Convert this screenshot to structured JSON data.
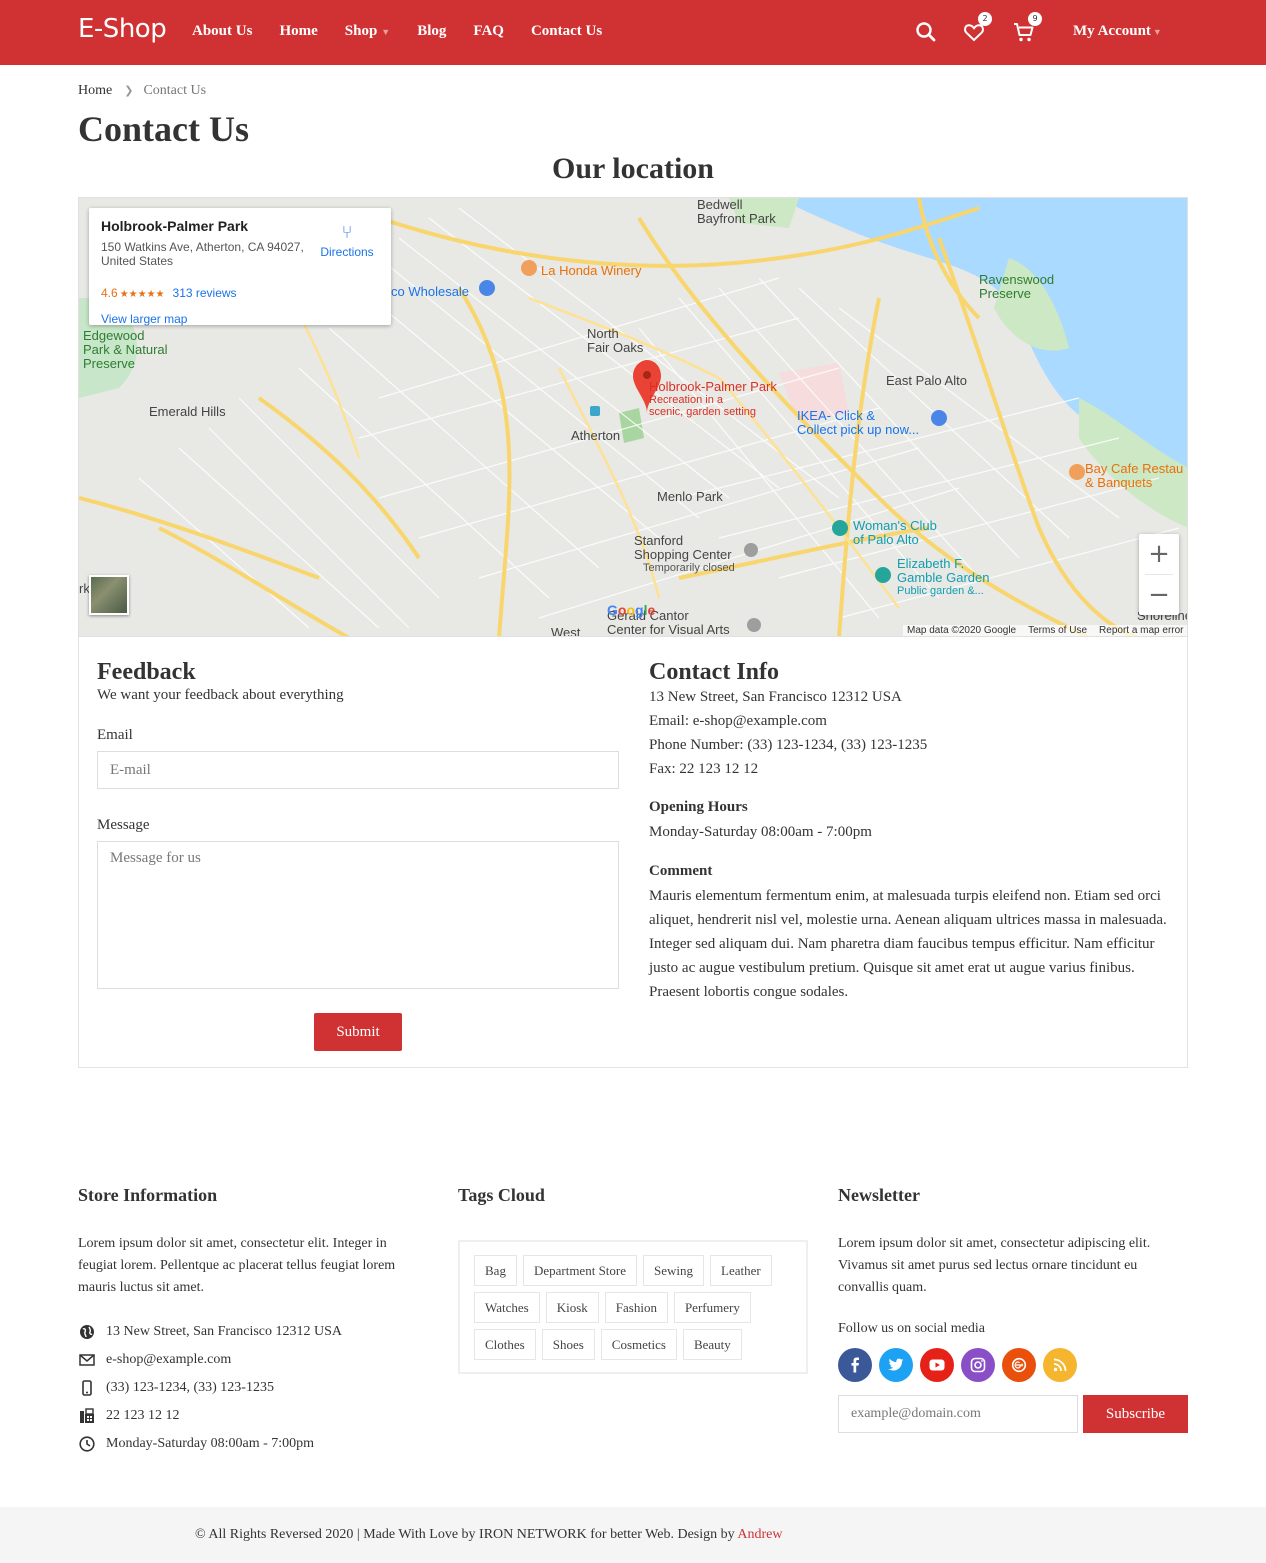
{
  "brand": {
    "logo": "E-Shop",
    "accent": "#d03233"
  },
  "nav": {
    "items": [
      "About Us",
      "Home",
      "Shop",
      "Blog",
      "FAQ",
      "Contact Us"
    ],
    "account_label": "My Account",
    "wishlist_count": "2",
    "cart_count": "9"
  },
  "breadcrumb": {
    "home": "Home",
    "current": "Contact Us"
  },
  "page": {
    "title": "Contact Us",
    "location_title": "Our location"
  },
  "map": {
    "place_name": "Holbrook-Palmer Park",
    "address": "150 Watkins Ave, Atherton, CA 94027, United States",
    "rating": "4.6",
    "stars": "★★★★★",
    "reviews": "313 reviews",
    "directions": "Directions",
    "larger_map": "View larger map",
    "labels": {
      "bedwell": "Bedwell\nBayfront Park",
      "la_honda": "La Honda Winery",
      "wholesale": "co Wholesale",
      "ravenswood": "Ravenswood\nPreserve",
      "edgewood": "Edgewood\nPark & Natural\nPreserve",
      "north_fair_oaks": "North\nFair Oaks",
      "pin_title": "Holbrook-Palmer Park",
      "pin_desc": "Recreation in a\nscenic, garden setting",
      "east_palo_alto": "East Palo Alto",
      "ikea": "IKEA- Click &\nCollect pick up now...",
      "emerald_hills": "Emerald Hills",
      "atherton": "Atherton",
      "bay_cafe": "Bay Cafe Restau\n& Banquets",
      "menlo_park": "Menlo Park",
      "womans_club": "Woman's Club\nof Palo Alto",
      "stanford": "Stanford\nShopping Center",
      "temporarily_closed": "Temporarily closed",
      "elizabeth": "Elizabeth F.\nGamble Garden",
      "public_garden": "Public garden &...",
      "cantor": "Gerald Cantor\nCenter for Visual Arts",
      "shoreline": "Shoreline",
      "west": "West",
      "rk": "rk"
    },
    "google": "Google",
    "footer": {
      "data": "Map data ©2020 Google",
      "terms": "Terms of Use",
      "report": "Report a map error"
    }
  },
  "feedback": {
    "title": "Feedback",
    "subtitle": "We want your feedback about everything",
    "email_label": "Email",
    "email_placeholder": "E-mail",
    "message_label": "Message",
    "message_placeholder": "Message for us",
    "submit": "Submit"
  },
  "contact": {
    "title": "Contact Info",
    "address": "13 New Street, San Francisco 12312 USA",
    "email": "Email: e-shop@example.com",
    "phone": "Phone Number: (33) 123-1234, (33) 123-1235",
    "fax": "Fax: 22 123 12 12",
    "hours_title": "Opening Hours",
    "hours": "Monday-Saturday 08:00am - 7:00pm",
    "comment_title": "Comment",
    "comment": "Mauris elementum fermentum enim, at malesuada turpis eleifend non. Etiam sed orci aliquet, hendrerit nisl vel, molestie urna. Aenean aliquam ultrices massa in malesuada. Integer sed aliquam dui. Nam pharetra diam faucibus tempus efficitur. Nam efficitur justo ac augue vestibulum pretium. Quisque sit amet erat ut augue varius finibus. Praesent lobortis congue sodales."
  },
  "footer": {
    "store": {
      "title": "Store Information",
      "text": "Lorem ipsum dolor sit amet, consectetur elit. Integer in feugiat lorem. Pellentque ac placerat tellus feugiat lorem mauris luctus sit amet.",
      "address": "13 New Street, San Francisco 12312 USA",
      "email": "e-shop@example.com",
      "phone": "(33) 123-1234, (33) 123-1235",
      "fax": "22 123 12 12",
      "hours": "Monday-Saturday 08:00am - 7:00pm"
    },
    "tags": {
      "title": "Tags Cloud",
      "items": [
        "Bag",
        "Department Store",
        "Sewing",
        "Leather",
        "Watches",
        "Kiosk",
        "Fashion",
        "Perfumery",
        "Clothes",
        "Shoes",
        "Cosmetics",
        "Beauty"
      ]
    },
    "newsletter": {
      "title": "Newsletter",
      "text": "Lorem ipsum dolor sit amet, consectetur adipiscing elit. Vivamus sit amet purus sed lectus ornare tincidunt eu convallis quam.",
      "follow": "Follow us on social media",
      "placeholder": "example@domain.com",
      "subscribe": "Subscribe",
      "social_colors": [
        "#3b5998",
        "#1da1f2",
        "#e62117",
        "#8a4fc7",
        "#e8500c",
        "#f5b52e"
      ]
    },
    "copyright": "© All Rights Reversed 2020 | Made With Love by IRON NETWORK for better Web. Design by",
    "author": "Andrew"
  }
}
